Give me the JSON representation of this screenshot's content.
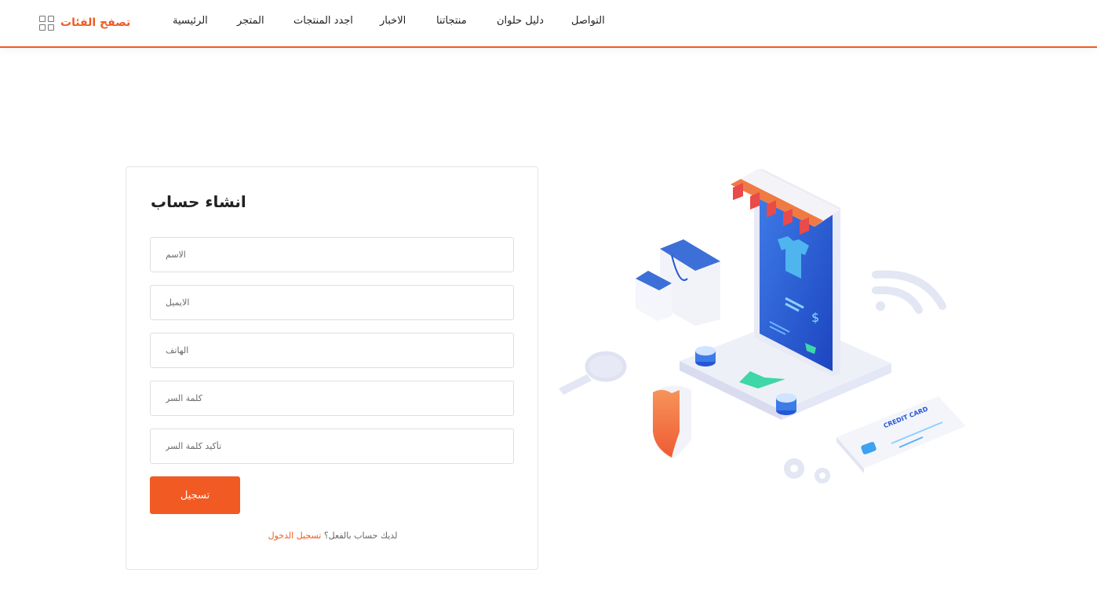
{
  "header": {
    "browse_label": "تصفح الفئات",
    "nav": [
      "الرئيسية",
      "المتجر",
      "اجدد المنتجات",
      "الاخبار",
      "منتجاتنا",
      "دليل حلوان",
      "التواصل"
    ]
  },
  "form": {
    "title": "انشاء حساب",
    "fields": {
      "name": "الاسم",
      "email": "الايميل",
      "phone": "الهاتف",
      "password": "كلمة السر",
      "confirm": "تأكيد كلمة السر"
    },
    "submit_label": "تسجيل",
    "have_account": "لديك حساب بالفعل؟",
    "login_link": "تسجيل الدخول"
  },
  "illustration": {
    "card_text": "CREDIT CARD",
    "colors": {
      "accent": "#f15a22",
      "phone_blue": "#2457d6",
      "awning_red": "#e94a4a"
    }
  }
}
